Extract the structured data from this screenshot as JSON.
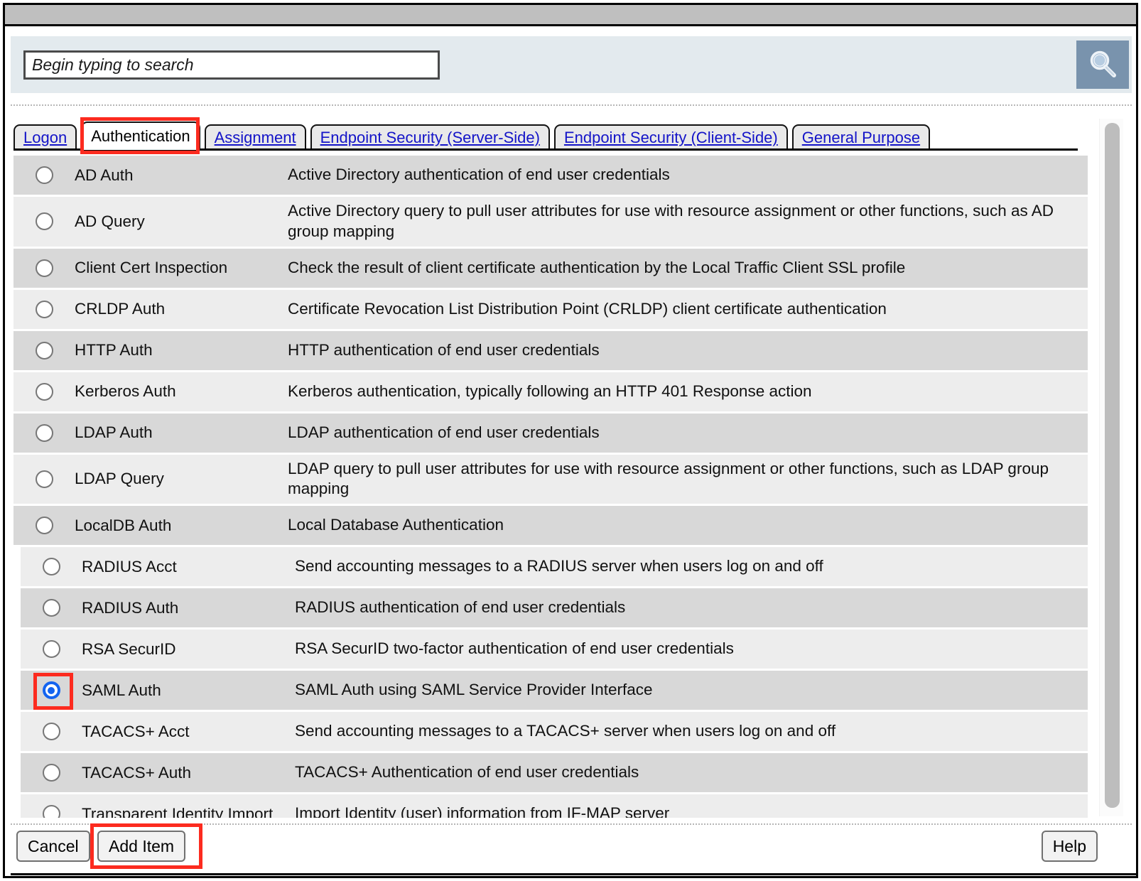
{
  "window": {
    "title": ""
  },
  "search": {
    "placeholder": "Begin typing to search",
    "value": "",
    "button_icon": "search-icon"
  },
  "tabs": [
    {
      "label": "Logon",
      "active": false
    },
    {
      "label": "Authentication",
      "active": true
    },
    {
      "label": "Assignment",
      "active": false
    },
    {
      "label": "Endpoint Security (Server-Side)",
      "active": false
    },
    {
      "label": "Endpoint Security (Client-Side)",
      "active": false
    },
    {
      "label": "General Purpose",
      "active": false
    }
  ],
  "list": {
    "items": [
      {
        "name": "AD Auth",
        "description": "Active Directory authentication of end user credentials",
        "selected": false
      },
      {
        "name": "AD Query",
        "description": "Active Directory query to pull user attributes for use with resource assignment or other functions, such as AD group mapping",
        "selected": false
      },
      {
        "name": "Client Cert Inspection",
        "description": "Check the result of client certificate authentication by the Local Traffic Client SSL profile",
        "selected": false
      },
      {
        "name": "CRLDP Auth",
        "description": "Certificate Revocation List Distribution Point (CRLDP) client certificate authentication",
        "selected": false
      },
      {
        "name": "HTTP Auth",
        "description": "HTTP authentication of end user credentials",
        "selected": false
      },
      {
        "name": "Kerberos Auth",
        "description": "Kerberos authentication, typically following an HTTP 401 Response action",
        "selected": false
      },
      {
        "name": "LDAP Auth",
        "description": "LDAP authentication of end user credentials",
        "selected": false
      },
      {
        "name": "LDAP Query",
        "description": "LDAP query to pull user attributes for use with resource assignment or other functions, such as LDAP group mapping",
        "selected": false
      },
      {
        "name": "LocalDB Auth",
        "description": "Local Database Authentication",
        "selected": false
      },
      {
        "name": "RADIUS Acct",
        "description": "Send accounting messages to a RADIUS server when users log on and off",
        "selected": false
      },
      {
        "name": "RADIUS Auth",
        "description": "RADIUS authentication of end user credentials",
        "selected": false
      },
      {
        "name": "RSA SecurID",
        "description": "RSA SecurID two-factor authentication of end user credentials",
        "selected": false
      },
      {
        "name": "SAML Auth",
        "description": "SAML Auth using SAML Service Provider Interface",
        "selected": true
      },
      {
        "name": "TACACS+ Acct",
        "description": "Send accounting messages to a TACACS+ server when users log on and off",
        "selected": false
      },
      {
        "name": "TACACS+ Auth",
        "description": "TACACS+ Authentication of end user credentials",
        "selected": false
      },
      {
        "name": "Transparent Identity Import",
        "description": "Import Identity (user) information from IF-MAP server",
        "selected": false
      }
    ]
  },
  "footer": {
    "cancel_label": "Cancel",
    "add_label": "Add Item",
    "help_label": "Help"
  },
  "colors": {
    "highlight": "#fc2b1f",
    "accent": "#1464f0",
    "link": "#1414c8",
    "row_even": "#d8d8d8",
    "row_odd": "#ededed",
    "search_band": "#e3eaee",
    "search_button": "#7993ad",
    "titlebar": "#bfbfbf"
  }
}
